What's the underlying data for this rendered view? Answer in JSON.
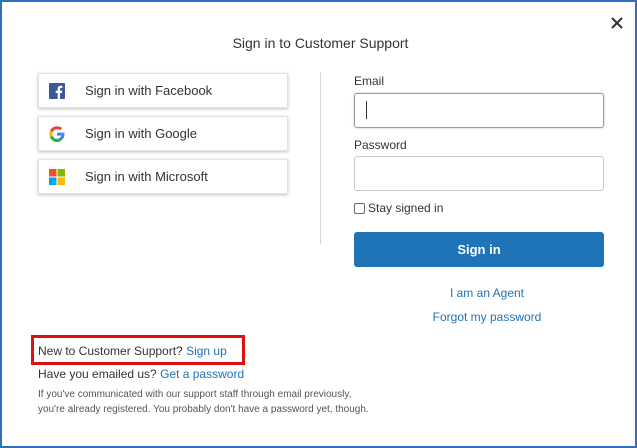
{
  "dialog": {
    "title": "Sign in to Customer Support"
  },
  "social": {
    "facebook_label": "Sign in with Facebook",
    "google_label": "Sign in with Google",
    "microsoft_label": "Sign in with Microsoft"
  },
  "form": {
    "email_label": "Email",
    "email_value": "",
    "password_label": "Password",
    "password_value": "",
    "stay_signed_in_label": "Stay signed in",
    "stay_signed_in_checked": false,
    "signin_label": "Sign in"
  },
  "links": {
    "agent": "I am an Agent",
    "forgot_password": "Forgot my password"
  },
  "footer": {
    "new_prefix": "New to Customer Support?",
    "signup_link": "Sign up",
    "emailed_prefix": "Have you emailed us?",
    "get_password_link": "Get a password",
    "info_line1": "If you've communicated with our support staff through email previously,",
    "info_line2": "you're already registered. You probably don't have a password yet, though."
  },
  "colors": {
    "accent": "#1f73b7",
    "frame_border": "#2f6fbd",
    "highlight": "#e01010",
    "facebook": "#3b5998"
  },
  "icons": {
    "close": "close-icon",
    "facebook": "facebook-icon",
    "google": "google-icon",
    "microsoft": "microsoft-icon"
  }
}
